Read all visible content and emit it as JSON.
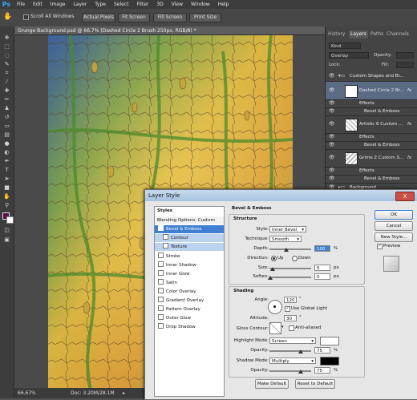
{
  "app": {
    "logo": "Ps"
  },
  "menu": [
    "File",
    "Edit",
    "Image",
    "Layer",
    "Type",
    "Select",
    "Filter",
    "3D",
    "View",
    "Window",
    "Help"
  ],
  "options_bar": {
    "scroll_all": "Scroll All Windows",
    "buttons": [
      "Actual Pixels",
      "Fit Screen",
      "Fill Screen",
      "Print Size"
    ]
  },
  "document": {
    "tab_title": "Grunge Background.psd @ 66.7% (Dashed Circle 2 Brush 250px, RGB/8) *",
    "zoom": "66.67%",
    "doc_size": "Doc: 3.20M/28.1M"
  },
  "layers_panel": {
    "tabs": [
      "History",
      "Layers",
      "Paths",
      "Channels"
    ],
    "active_tab": "Layers",
    "filter_kind": "Kind",
    "blend_mode": "Overlay",
    "opacity_label": "Opacity:",
    "fill_label": "Fill:",
    "lock_label": "Lock:",
    "rows": [
      {
        "name": "Custom Shapes and Br...",
        "type": "group"
      },
      {
        "name": "Dashed Circle 2 Br...",
        "type": "layer",
        "fx": "fx"
      },
      {
        "name": "Effects",
        "type": "effects"
      },
      {
        "name": "Bevel & Emboss",
        "type": "effect"
      },
      {
        "name": "Artistic 6 Custom ...",
        "type": "layer",
        "fx": "fx"
      },
      {
        "name": "Effects",
        "type": "effects"
      },
      {
        "name": "Bevel & Emboss",
        "type": "effect"
      },
      {
        "name": "Grime 2 Custom S...",
        "type": "layer",
        "fx": "fx"
      },
      {
        "name": "Effects",
        "type": "effects"
      },
      {
        "name": "Bevel & Emboss",
        "type": "effect"
      },
      {
        "name": "Background",
        "type": "group"
      }
    ]
  },
  "dialog": {
    "title": "Layer Style",
    "close": "X",
    "styles_header": "Styles",
    "styles_list": [
      {
        "label": "Blending Options: Custom",
        "check": false,
        "state": "header"
      },
      {
        "label": "Bevel & Emboss",
        "check": true,
        "state": "selected"
      },
      {
        "label": "Contour",
        "check": false,
        "state": "sub"
      },
      {
        "label": "Texture",
        "check": false,
        "state": "sub"
      },
      {
        "label": "Stroke",
        "check": false,
        "state": ""
      },
      {
        "label": "Inner Shadow",
        "check": false,
        "state": ""
      },
      {
        "label": "Inner Glow",
        "check": false,
        "state": ""
      },
      {
        "label": "Satin",
        "check": false,
        "state": ""
      },
      {
        "label": "Color Overlay",
        "check": false,
        "state": ""
      },
      {
        "label": "Gradient Overlay",
        "check": false,
        "state": ""
      },
      {
        "label": "Pattern Overlay",
        "check": false,
        "state": ""
      },
      {
        "label": "Outer Glow",
        "check": false,
        "state": ""
      },
      {
        "label": "Drop Shadow",
        "check": false,
        "state": ""
      }
    ],
    "section_title": "Bevel & Emboss",
    "structure": {
      "title": "Structure",
      "style_label": "Style:",
      "style_value": "Inner Bevel",
      "technique_label": "Technique:",
      "technique_value": "Smooth",
      "depth_label": "Depth:",
      "depth_value": "100",
      "depth_unit": "%",
      "direction_label": "Direction:",
      "direction_up": "Up",
      "direction_down": "Down",
      "size_label": "Size:",
      "size_value": "5",
      "size_unit": "px",
      "soften_label": "Soften:",
      "soften_value": "0",
      "soften_unit": "px"
    },
    "shading": {
      "title": "Shading",
      "angle_label": "Angle:",
      "angle_value": "120",
      "angle_unit": "°",
      "global_light": "Use Global Light",
      "altitude_label": "Altitude:",
      "altitude_value": "30",
      "altitude_unit": "°",
      "gloss_label": "Gloss Contour:",
      "anti_aliased": "Anti-aliased",
      "highlight_label": "Highlight Mode:",
      "highlight_value": "Screen",
      "highlight_opacity_label": "Opacity:",
      "highlight_opacity": "75",
      "highlight_unit": "%",
      "shadow_label": "Shadow Mode:",
      "shadow_value": "Multiply",
      "shadow_opacity_label": "Opacity:",
      "shadow_opacity": "75",
      "shadow_unit": "%"
    },
    "make_default": "Make Default",
    "reset_default": "Reset to Default",
    "ok": "OK",
    "cancel": "Cancel",
    "new_style": "New Style...",
    "preview": "Preview"
  }
}
